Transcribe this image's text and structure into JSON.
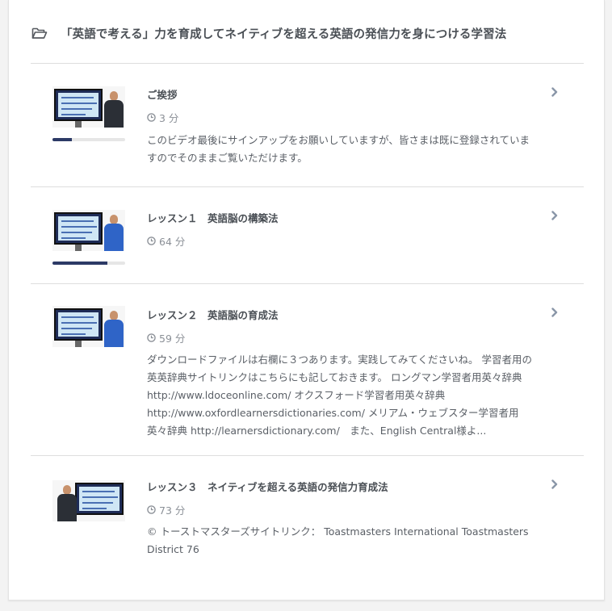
{
  "section": {
    "icon": "folder-open-icon",
    "title": "「英語で考える」力を育成してネイティブを超える英語の発信力を身につける学習法"
  },
  "lectures": [
    {
      "title": "ご挨拶",
      "duration": "3 分",
      "description": "このビデオ最後にサインアップをお願いしていますが、皆さまは既に登録されていますのでそのままご覧いただけます。",
      "progress": 0.27,
      "thumbnail_variant": "dark-suit"
    },
    {
      "title": "レッスン１　英語脳の構築法",
      "duration": "64 分",
      "description": "",
      "progress": 0.75,
      "thumbnail_variant": "blue-suit"
    },
    {
      "title": "レッスン２　英語脳の育成法",
      "duration": "59 分",
      "description": "ダウンロードファイルは右欄に３つあります。実践してみてくださいね。 学習者用の英英辞典サイトリンクはこちらにも記しておきます。 ロングマン学習者用英々辞典http://www.ldoceonline.com/ オクスフォード学習者用英々辞典 http://www.oxfordlearnersdictionaries.com/ メリアム・ウェブスター学習者用英々辞典 http://learnersdictionary.com/　また、English Central様よ...",
      "progress": 0,
      "thumbnail_variant": "blue-suit"
    },
    {
      "title": "レッスン３　ネイティブを超える英語の発信力育成法",
      "duration": "73 分",
      "description": "© トーストマスターズサイトリンク： Toastmasters International Toastmasters District 76",
      "progress": 0,
      "thumbnail_variant": "dark-suit-left"
    }
  ],
  "colors": {
    "progress_fill": "#2c3a66",
    "chevron": "#8a96a8",
    "clock": "#8b9097"
  }
}
